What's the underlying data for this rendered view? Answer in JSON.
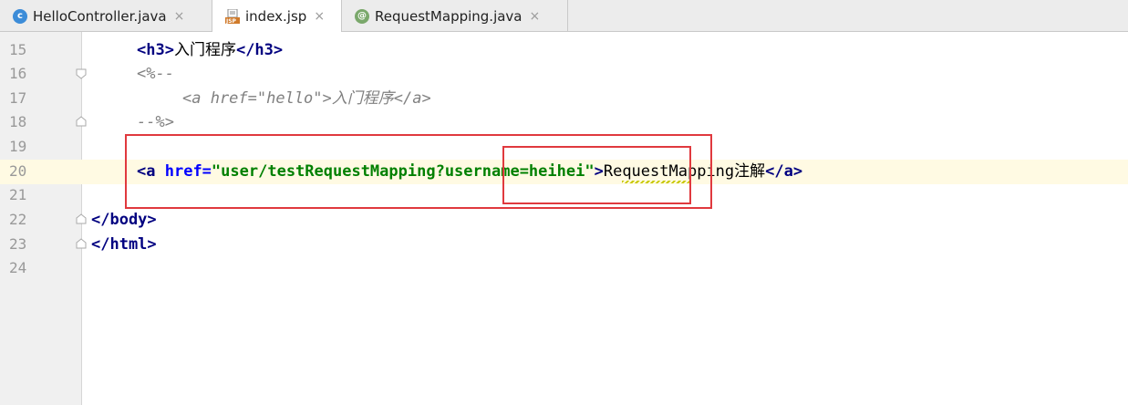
{
  "tabs": [
    {
      "label": "HelloController.java",
      "icon": "java-class-icon",
      "active": false
    },
    {
      "label": "index.jsp",
      "icon": "jsp-file-icon",
      "active": true
    },
    {
      "label": "RequestMapping.java",
      "icon": "annotation-icon",
      "active": false
    }
  ],
  "close_glyph": "×",
  "lines": [
    {
      "num": "15"
    },
    {
      "num": "16"
    },
    {
      "num": "17"
    },
    {
      "num": "18"
    },
    {
      "num": "19"
    },
    {
      "num": "20"
    },
    {
      "num": "21"
    },
    {
      "num": "22"
    },
    {
      "num": "23"
    },
    {
      "num": "24"
    }
  ],
  "code": {
    "l15": {
      "open": "<h3>",
      "text": "入门程序",
      "close": "</h3>"
    },
    "l16": "<%--",
    "l17": {
      "open": "<a href=\"hello\">",
      "text": "入门程序",
      "close": "</a>"
    },
    "l18": "--%>",
    "l20": {
      "tag_open": "<a",
      "attr": "href=",
      "q1": "\"",
      "val_path": "user/testRequestMapping",
      "val_query": "?username=heihei",
      "q2": "\"",
      "gt": ">",
      "text": "RequestMapping注解",
      "close": "</a>"
    },
    "l22": "</body>",
    "l23": "</html>"
  },
  "highlight_color": "#e0393e"
}
